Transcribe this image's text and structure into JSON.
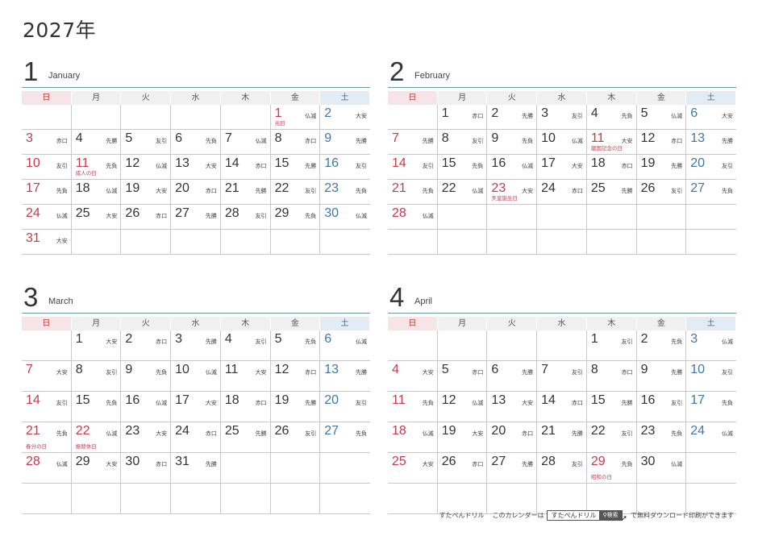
{
  "title": "2027年",
  "weekdays": [
    "日",
    "月",
    "火",
    "水",
    "木",
    "金",
    "土"
  ],
  "months": [
    {
      "num": "1",
      "name": "January",
      "start": 5,
      "days": 31,
      "rokuyo": [
        "仏滅",
        "大安",
        "赤口",
        "先勝",
        "友引",
        "先負",
        "仏滅",
        "赤口",
        "先勝",
        "友引",
        "先負",
        "仏滅",
        "大安",
        "赤口",
        "先勝",
        "友引",
        "先負",
        "仏滅",
        "大安",
        "赤口",
        "先勝",
        "友引",
        "先負",
        "仏滅",
        "大安",
        "赤口",
        "先勝",
        "友引",
        "先負",
        "仏滅",
        "大安"
      ],
      "holidays": {
        "1": "元日",
        "11": "成人の日"
      }
    },
    {
      "num": "2",
      "name": "February",
      "start": 1,
      "days": 28,
      "rokuyo": [
        "赤口",
        "先勝",
        "友引",
        "先負",
        "仏滅",
        "大安",
        "先勝",
        "友引",
        "先負",
        "仏滅",
        "大安",
        "赤口",
        "先勝",
        "友引",
        "先負",
        "仏滅",
        "大安",
        "赤口",
        "先勝",
        "友引",
        "先負",
        "仏滅",
        "大安",
        "赤口",
        "先勝",
        "友引",
        "先負",
        "仏滅"
      ],
      "holidays": {
        "11": "建国記念の日",
        "23": "天皇誕生日"
      }
    },
    {
      "num": "3",
      "name": "March",
      "start": 1,
      "days": 31,
      "rokuyo": [
        "大安",
        "赤口",
        "先勝",
        "友引",
        "先負",
        "仏滅",
        "大安",
        "友引",
        "先負",
        "仏滅",
        "大安",
        "赤口",
        "先勝",
        "友引",
        "先負",
        "仏滅",
        "大安",
        "赤口",
        "先勝",
        "友引",
        "先負",
        "仏滅",
        "大安",
        "赤口",
        "先勝",
        "友引",
        "先負",
        "仏滅",
        "大安",
        "赤口",
        "先勝"
      ],
      "holidays": {
        "21": "春分の日",
        "22": "振替休日"
      }
    },
    {
      "num": "4",
      "name": "April",
      "start": 4,
      "days": 30,
      "rokuyo": [
        "友引",
        "先負",
        "仏滅",
        "大安",
        "赤口",
        "先勝",
        "友引",
        "赤口",
        "先勝",
        "友引",
        "先負",
        "仏滅",
        "大安",
        "赤口",
        "先勝",
        "友引",
        "先負",
        "仏滅",
        "大安",
        "赤口",
        "先勝",
        "友引",
        "先負",
        "仏滅",
        "大安",
        "赤口",
        "先勝",
        "友引",
        "先負",
        "仏滅"
      ],
      "holidays": {
        "29": "昭和の日"
      }
    }
  ],
  "footer": {
    "site": "すたぺんドリル",
    "lead": "このカレンダーは",
    "search_text": "すたぺんドリル",
    "search_button": "検索",
    "tail": "で無料ダウンロード印刷ができます"
  }
}
